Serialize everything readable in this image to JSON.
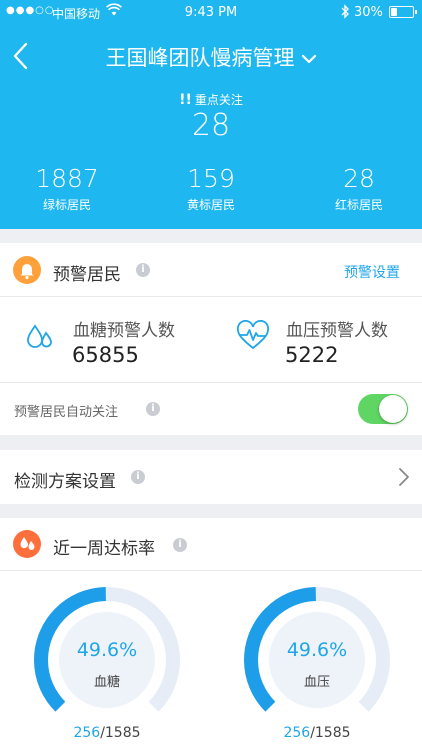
{
  "status_bar": {
    "signal": "●●●○○",
    "carrier": "中国移动",
    "time": "9:43 PM",
    "battery": "30%",
    "battery_level": 0.3
  },
  "header": {
    "title": "王国峰团队慢病管理",
    "focus_label": "重点关注",
    "focus_value": "28",
    "stats": [
      {
        "value": "1887",
        "label": "绿标居民"
      },
      {
        "value": "159",
        "label": "黄标居民"
      },
      {
        "value": "28",
        "label": "红标居民"
      }
    ]
  },
  "warning": {
    "title": "预警居民",
    "settings_link": "预警设置",
    "blood_sugar_label": "血糖预警人数",
    "blood_sugar_value": "65855",
    "blood_pressure_label": "血压预警人数",
    "blood_pressure_value": "5222",
    "auto_follow_label": "预警居民自动关注",
    "auto_follow_on": true
  },
  "plan": {
    "title": "检测方案设置"
  },
  "weekly": {
    "title": "近一周达标率",
    "gauges": [
      {
        "percent_text": "49.6%",
        "label": "血糖",
        "done": "256",
        "total": "/1585",
        "fraction": 0.496
      },
      {
        "percent_text": "49.6%",
        "label": "血压",
        "done": "256",
        "total": "/1585",
        "fraction": 0.496
      }
    ]
  },
  "colors": {
    "header_bg": "#1fb7ef",
    "accent": "#1fa6e8",
    "bell_icon_bg": "#ffa13a",
    "drop_icon_bg": "#ff6f3c",
    "toggle_on": "#5fd664",
    "gauge_track": "#e6edf7",
    "gauge_fill": "#1e9ee9"
  }
}
